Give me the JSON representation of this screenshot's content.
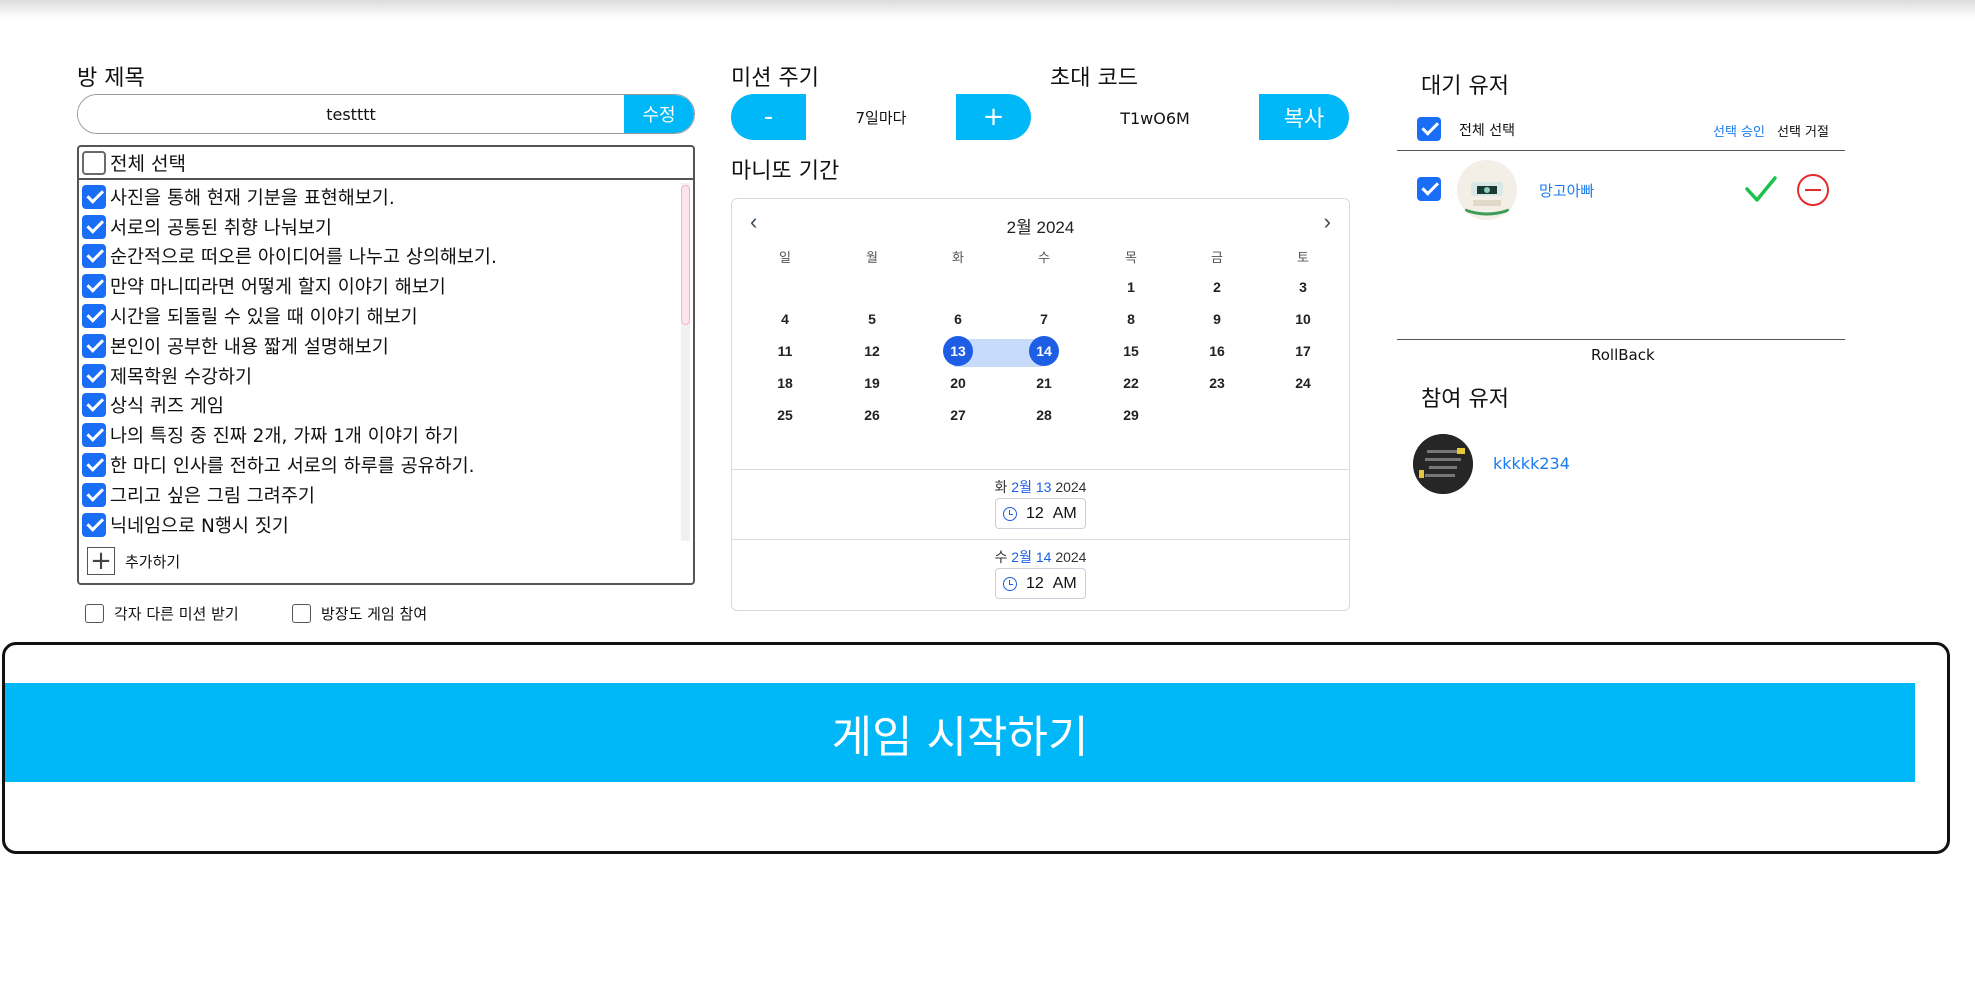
{
  "room": {
    "title_label": "방 제목",
    "title_value": "testttt",
    "edit_label": "수정"
  },
  "missions": {
    "select_all_label": "전체 선택",
    "select_all_checked": false,
    "items": [
      {
        "label": "사진을 통해 현재 기분을 표현해보기.",
        "checked": true
      },
      {
        "label": "서로의 공통된 취향 나눠보기",
        "checked": true
      },
      {
        "label": "순간적으로 떠오른 아이디어를 나누고 상의해보기.",
        "checked": true
      },
      {
        "label": "만약 마니띠라면 어떻게 할지 이야기 해보기",
        "checked": true
      },
      {
        "label": "시간을 되돌릴 수 있을 때 이야기 해보기",
        "checked": true
      },
      {
        "label": "본인이 공부한 내용 짧게 설명해보기",
        "checked": true
      },
      {
        "label": "제목학원 수강하기",
        "checked": true
      },
      {
        "label": "상식 퀴즈 게임",
        "checked": true
      },
      {
        "label": "나의 특징 중 진짜 2개, 가짜 1개 이야기 하기",
        "checked": true
      },
      {
        "label": "한 마디 인사를 전하고 서로의 하루를 공유하기.",
        "checked": true
      },
      {
        "label": "그리고 싶은 그림 그려주기",
        "checked": true
      },
      {
        "label": "닉네임으로 N행시 짓기",
        "checked": true
      }
    ],
    "add_label": "추가하기",
    "add_icon": "plus-icon"
  },
  "options": {
    "different_mission_label": "각자 다른 미션 받기",
    "host_join_label": "방장도 게임 참여"
  },
  "mission_period": {
    "label": "미션 주기",
    "minus_label": "-",
    "plus_label": "+",
    "value": "7일마다"
  },
  "invite": {
    "label": "초대 코드",
    "code": "T1wO6M",
    "copy_label": "복사"
  },
  "manitto_period": {
    "label": "마니또 기간",
    "month_title": "2월 2024",
    "weekdays": [
      "일",
      "월",
      "화",
      "수",
      "목",
      "금",
      "토"
    ],
    "weeks": [
      [
        "",
        "",
        "",
        "",
        "1",
        "2",
        "3"
      ],
      [
        "4",
        "5",
        "6",
        "7",
        "8",
        "9",
        "10"
      ],
      [
        "11",
        "12",
        "13",
        "14",
        "15",
        "16",
        "17"
      ],
      [
        "18",
        "19",
        "20",
        "21",
        "22",
        "23",
        "24"
      ],
      [
        "25",
        "26",
        "27",
        "28",
        "29",
        "",
        ""
      ]
    ],
    "selected_start": "13",
    "selected_end": "14",
    "start": {
      "weekday": "화",
      "date": "2월 13",
      "year": "2024",
      "time": "12",
      "ampm": "AM"
    },
    "end": {
      "weekday": "수",
      "date": "2월 14",
      "year": "2024",
      "time": "12",
      "ampm": "AM"
    }
  },
  "waiting_users": {
    "label": "대기 유저",
    "select_all_label": "전체 선택",
    "approve_label": "선택 승인",
    "reject_label": "선택 거절",
    "users": [
      {
        "name": "망고아빠",
        "checked": true
      }
    ],
    "rollback_label": "RollBack"
  },
  "participants": {
    "label": "참여 유저",
    "users": [
      {
        "name": "kkkkk234"
      }
    ]
  },
  "start_button": {
    "label": "게임 시작하기"
  },
  "colors": {
    "accent": "#00b7f7",
    "checkbox": "#1a6ef5",
    "calendar_select": "#1d5ee4",
    "range": "#c7dcfb",
    "approve_green": "#19c24a",
    "reject_red": "#e62b2b"
  }
}
